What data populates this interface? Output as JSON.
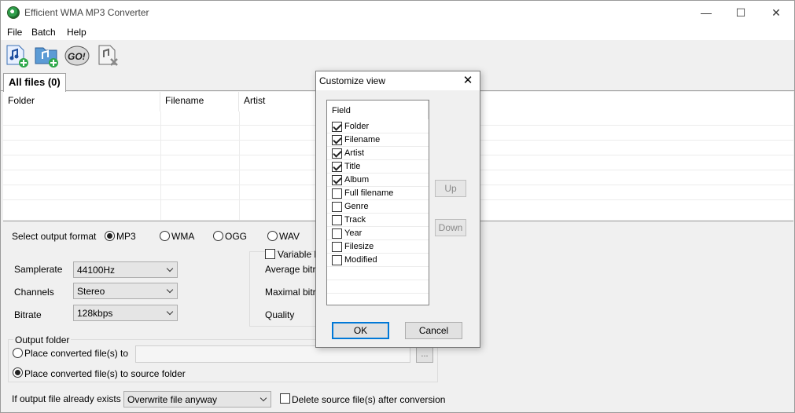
{
  "window": {
    "title": "Efficient WMA MP3 Converter",
    "controls": {
      "minimize": "—",
      "maximize": "☐",
      "close": "✕"
    }
  },
  "menu": [
    "File",
    "Batch",
    "Help"
  ],
  "toolbar": {
    "buttons": [
      {
        "icon": "add-file-icon"
      },
      {
        "icon": "add-folder-icon"
      },
      {
        "icon": "go-convert-icon",
        "text": "GO!"
      },
      {
        "icon": "remove-file-icon"
      }
    ]
  },
  "tabs": {
    "all_files": "All files (0)"
  },
  "file_list": {
    "columns": [
      "Folder",
      "Filename",
      "Artist"
    ]
  },
  "settings": {
    "output_format_label": "Select output format",
    "formats": [
      {
        "label": "MP3",
        "selected": true
      },
      {
        "label": "WMA",
        "selected": false
      },
      {
        "label": "OGG",
        "selected": false
      },
      {
        "label": "WAV",
        "selected": false
      }
    ],
    "samplerate_label": "Samplerate",
    "samplerate_value": "44100Hz",
    "channels_label": "Channels",
    "channels_value": "Stereo",
    "bitrate_label": "Bitrate",
    "bitrate_value": "128kbps",
    "variable_bitrate_label": "Variable bi",
    "average_bitrate_label": "Average bitra",
    "maximal_bitrate_label": "Maximal bitrat",
    "quality_label": "Quality",
    "output_folder_label": "Output folder",
    "place_to_label": "Place converted file(s) to",
    "place_source_label": "Place converted file(s) to source folder",
    "browse_label": "...",
    "exists_label": "If output file already exists",
    "exists_value": "Overwrite file anyway",
    "delete_source_label": "Delete source file(s) after conversion"
  },
  "dialog": {
    "title": "Customize view",
    "close": "✕",
    "field_header": "Field",
    "fields": [
      {
        "label": "Folder",
        "checked": true
      },
      {
        "label": "Filename",
        "checked": true
      },
      {
        "label": "Artist",
        "checked": true
      },
      {
        "label": "Title",
        "checked": true
      },
      {
        "label": "Album",
        "checked": true
      },
      {
        "label": "Full filename",
        "checked": false
      },
      {
        "label": "Genre",
        "checked": false
      },
      {
        "label": "Track",
        "checked": false
      },
      {
        "label": "Year",
        "checked": false
      },
      {
        "label": "Filesize",
        "checked": false
      },
      {
        "label": "Modified",
        "checked": false
      }
    ],
    "up_label": "Up",
    "down_label": "Down",
    "ok_label": "OK",
    "cancel_label": "Cancel"
  },
  "colors": {
    "accent": "#0078d7",
    "background": "#f0f0f0"
  }
}
